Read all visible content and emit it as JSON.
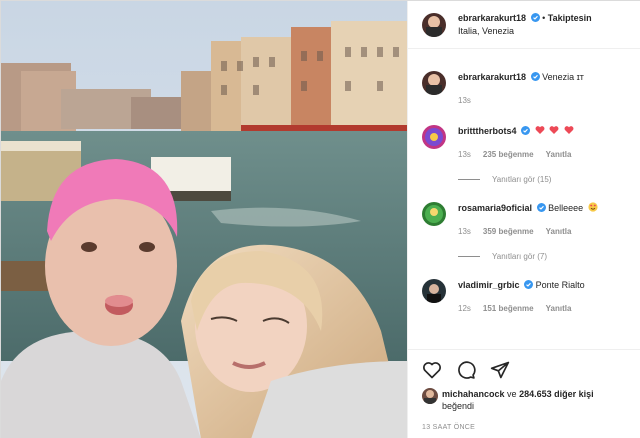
{
  "post": {
    "photo_alt": "Selfie on Venice canal"
  },
  "header": {
    "username": "ebrarkarakurt18",
    "separator": "•",
    "follow_status": "Takiptesin",
    "location": "Italia, Venezia"
  },
  "caption": {
    "username": "ebrarkarakurt18",
    "text": "Venezia ɪᴛ",
    "time": "13s"
  },
  "comments": [
    {
      "username": "britttherbots4",
      "text": "",
      "time": "13s",
      "likes": "235 beğenme",
      "reply_label": "Yanıtla",
      "replies": "Yanıtları gör (15)",
      "avatar_color": "#c13584"
    },
    {
      "username": "rosamaria9oficial",
      "text": "Belleeee",
      "time": "13s",
      "likes": "359 beğenme",
      "reply_label": "Yanıtla",
      "replies": "Yanıtları gör (7)",
      "avatar_color": "#2e7d32"
    },
    {
      "username": "vladimir_grbic",
      "text": "Ponte Rialto",
      "time": "12s",
      "likes": "151 beğenme",
      "reply_label": "Yanıtla",
      "replies": "",
      "avatar_color": "#263238"
    }
  ],
  "likes": {
    "first_user": "michahancock",
    "connector": "ve",
    "count_text": "284.653 diğer kişi",
    "suffix": "beğendi"
  },
  "timestamp": "13 SAAT ÖNCE",
  "icons": [
    "heart-icon",
    "comment-icon",
    "share-icon"
  ],
  "colors": {
    "verified": "#3897f0",
    "heart": "#ed4956",
    "link": "#0095f6"
  }
}
